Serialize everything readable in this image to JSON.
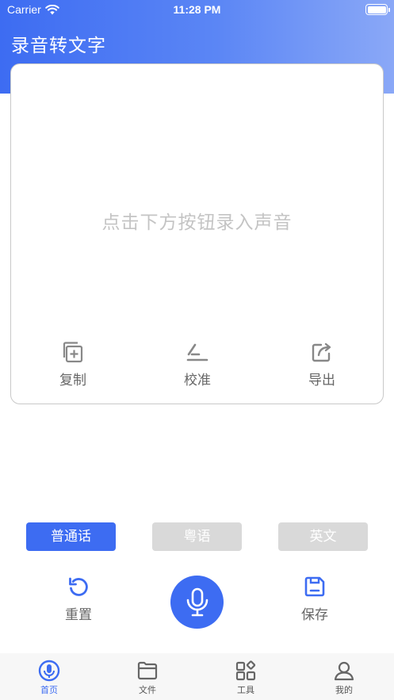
{
  "status_bar": {
    "carrier": "Carrier",
    "time": "11:28 PM"
  },
  "header": {
    "title": "录音转文字"
  },
  "result_card": {
    "placeholder": "点击下方按钮录入声音",
    "actions": [
      {
        "label": "复制",
        "icon": "copy-icon"
      },
      {
        "label": "校准",
        "icon": "calibrate-icon"
      },
      {
        "label": "导出",
        "icon": "export-icon"
      }
    ]
  },
  "languages": [
    {
      "label": "普通话",
      "selected": true
    },
    {
      "label": "粤语",
      "selected": false
    },
    {
      "label": "英文",
      "selected": false
    }
  ],
  "controls": {
    "reset_label": "重置",
    "save_label": "保存",
    "mic_icon": "microphone-icon"
  },
  "tab_bar": {
    "items": [
      {
        "label": "首页",
        "icon": "home-icon",
        "active": true
      },
      {
        "label": "文件",
        "icon": "folder-icon",
        "active": false
      },
      {
        "label": "工具",
        "icon": "tools-icon",
        "active": false
      },
      {
        "label": "我的",
        "icon": "profile-icon",
        "active": false
      }
    ]
  },
  "colors": {
    "accent": "#3d6cf2",
    "inactive_button": "#d9d9d9",
    "placeholder": "#c4c4c4",
    "icon_gray": "#888888"
  }
}
